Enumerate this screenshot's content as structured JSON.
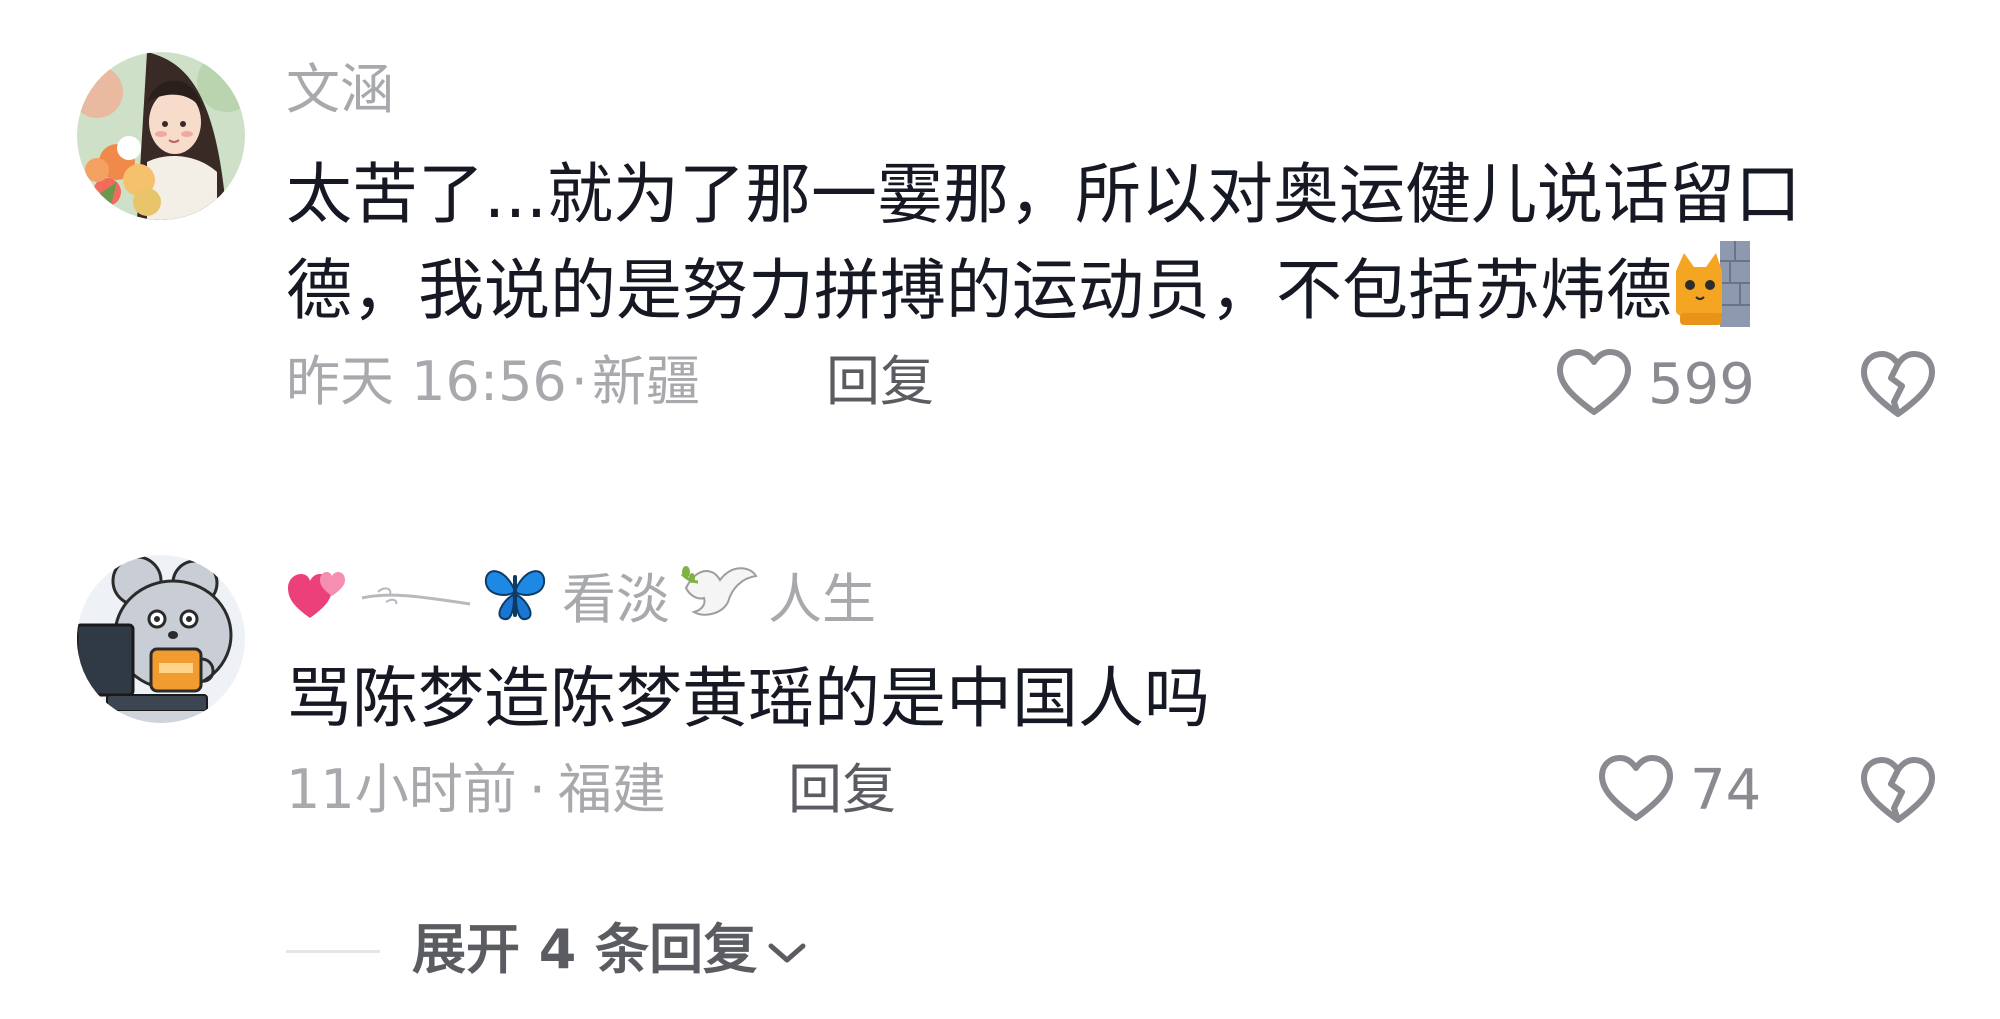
{
  "comments": [
    {
      "username": "文涵",
      "text": "太苦了...就为了那一霎那，所以对奥运健儿说话留口德，我说的是努力拼搏的运动员，不包括苏炜德",
      "time": "昨天 16:56",
      "location": "新疆",
      "meta_separator": "·",
      "reply_label": "回复",
      "likes": "599",
      "avatar_icon": "flower-girl-avatar",
      "inline_emoji_icon": "cat-peeking-emoji"
    },
    {
      "username_prefix_icons": [
        "two-hearts-icon",
        "wind-swirl-icon",
        "blue-butterfly-icon"
      ],
      "username_text_1": "看淡",
      "username_mid_icon": "dove-olive-branch-icon",
      "username_text_2": "人生",
      "text": "骂陈梦造陈梦黄瑶的是中国人吗",
      "time": "11小时前",
      "location": "福建",
      "meta_separator": "·",
      "reply_label": "回复",
      "likes": "74",
      "avatar_icon": "mouse-computer-avatar"
    }
  ],
  "expand_replies": {
    "label": "展开 4 条回复",
    "icon": "chevron-down-icon"
  },
  "colors": {
    "primary_text": "#161823",
    "secondary_text": "#a8a9ad",
    "reply_text": "#5b5c61",
    "icon_gray": "#8a8b91",
    "butterfly_blue": "#1e88e5",
    "heart_pink": "#ec407a"
  }
}
